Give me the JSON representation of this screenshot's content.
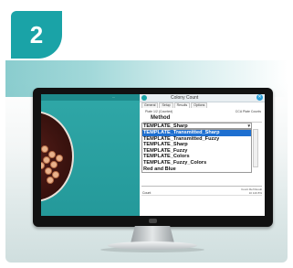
{
  "step_badge": "2",
  "workspace": {
    "label": "..."
  },
  "dialog": {
    "title": "Colony Count",
    "close_glyph": "✕",
    "tabs": [
      "General",
      "Setup",
      "Results",
      "Options"
    ],
    "subtitle": "Plate 1/2 (Counted)",
    "right_note": "CCA Plate Counts",
    "method_label": "Method",
    "selected_value": "TEMPLATE_Sharp",
    "options": [
      {
        "label": "TEMPLATE_Transmitted_Sharp",
        "selected": true
      },
      {
        "label": "TEMPLATE_Transmitted_Fuzzy",
        "selected": false
      },
      {
        "label": "TEMPLATE_Sharp",
        "selected": false
      },
      {
        "label": "TEMPLATE_Fuzzy",
        "selected": false
      },
      {
        "label": "TEMPLATE_Colors",
        "selected": false
      },
      {
        "label": "TEMPLATE_Fuzzy_Colors",
        "selected": false
      },
      {
        "label": "Red and Blue",
        "selected": false
      }
    ],
    "lower_head": "Count   Ref   Result",
    "lower_row_label": "Count",
    "lower_row_right": "10   120   8%"
  },
  "colors": {
    "accent": "#1aa3a7",
    "selection": "#1e6fd0"
  }
}
